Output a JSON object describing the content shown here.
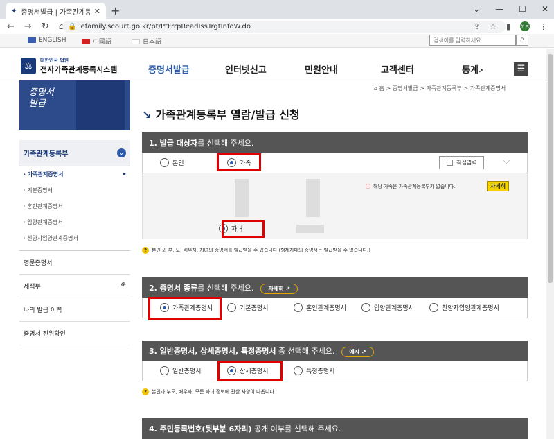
{
  "browser": {
    "tab_title": "증명서발급 | 가족관계등록부 | 전",
    "url": "efamily.scourt.go.kr/pt/PtFrrpReadIssTrgtInfoW.do",
    "new_tab": "+",
    "profile": "운동"
  },
  "langbar": {
    "english": "ENGLISH",
    "chinese": "中國語",
    "japanese": "日本語",
    "search_placeholder": "검색어를 입력하세요."
  },
  "header": {
    "logo_sub": "대한민국 법원",
    "logo_main": "전자가족관계등록시스템",
    "menu": [
      "증명서발급",
      "인터넷신고",
      "민원안내",
      "고객센터",
      "통계"
    ]
  },
  "sidebar": {
    "banner": "증명서\n발급",
    "section": "가족관계등록부",
    "items": [
      "가족관계증명서",
      "기본증명서",
      "혼인관계증명서",
      "입양관계증명서",
      "친양자입양관계증명서"
    ],
    "others": [
      "영문증명서",
      "제적부",
      "나의 발급 이력",
      "증명서 진위확인"
    ]
  },
  "breadcrumb": "⌂ 홈  >  증명서발급  >  가족관계등록부  >  가족관계증명서",
  "page_title": "가족관계등록부 열람/발급 신청",
  "step1": {
    "bold": "1. 발급 대상자",
    "rest": "를 선택해 주세요.",
    "opt_self": "본인",
    "opt_family": "가족",
    "direct_btn": "직접입력",
    "warning": "해당 가족은 가족관계등록부가 없습니다.",
    "detail": "자세히",
    "child": "자녀",
    "note": "본인 외 부, 모, 배우자, 자녀의 증명서를 발급받을 수 있습니다.(형제자매의 증명서는 발급받을 수 없습니다.)"
  },
  "step2": {
    "bold": "2. 증명서 종류",
    "rest": "를 선택해 주세요.",
    "detail_btn": "자세히",
    "options": [
      "가족관계증명서",
      "기본증명서",
      "혼인관계증명서",
      "입양관계증명서",
      "친양자입양관계증명서"
    ]
  },
  "step3": {
    "bold": "3. 일반증명서, 상세증명서, 특정증명서",
    "rest": " 중 선택해 주세요.",
    "example_btn": "예시",
    "options": [
      "일반증명서",
      "상세증명서",
      "특정증명서"
    ],
    "note": "본인과 부모, 배우자, 모든 자녀 정보에 관한 사항이 나옵니다."
  },
  "step4": {
    "bold": "4. 주민등록번호(뒷부분 6자리)",
    "rest": " 공개 여부를 선택해 주세요."
  }
}
